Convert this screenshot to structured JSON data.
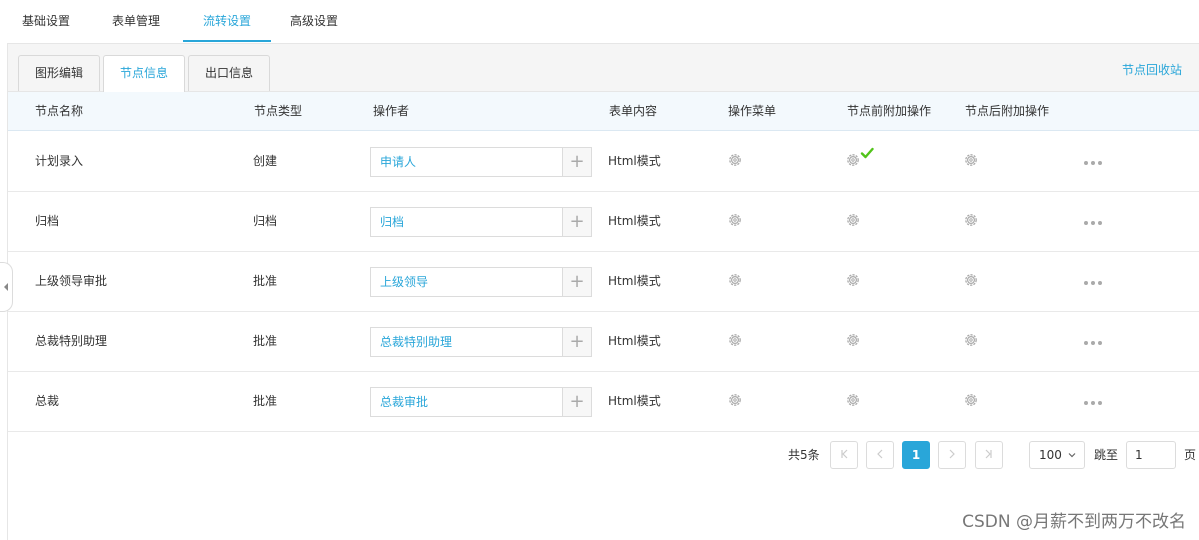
{
  "top_tabs": [
    {
      "label": "基础设置"
    },
    {
      "label": "表单管理"
    },
    {
      "label": "流转设置",
      "active": true
    },
    {
      "label": "高级设置"
    }
  ],
  "sub_tabs": [
    {
      "label": "图形编辑"
    },
    {
      "label": "节点信息",
      "active": true
    },
    {
      "label": "出口信息"
    }
  ],
  "recycle_label": "节点回收站",
  "columns": [
    "节点名称",
    "节点类型",
    "操作者",
    "表单内容",
    "操作菜单",
    "节点前附加操作",
    "节点后附加操作"
  ],
  "rows": [
    {
      "name": "计划录入",
      "type": "创建",
      "operator": "申请人",
      "form": "Html模式",
      "pre_configured": true
    },
    {
      "name": "归档",
      "type": "归档",
      "operator": "归档",
      "form": "Html模式",
      "pre_configured": false
    },
    {
      "name": "上级领导审批",
      "type": "批准",
      "operator": "上级领导",
      "form": "Html模式",
      "pre_configured": false
    },
    {
      "name": "总裁特别助理",
      "type": "批准",
      "operator": "总裁特别助理",
      "form": "Html模式",
      "pre_configured": false
    },
    {
      "name": "总裁",
      "type": "批准",
      "operator": "总裁审批",
      "form": "Html模式",
      "pre_configured": false
    }
  ],
  "pagination": {
    "total_text": "共5条",
    "current_page": "1",
    "page_size": "100",
    "jump_label": "跳至",
    "jump_value": "1",
    "page_suffix": "页"
  },
  "colors": {
    "accent": "#29a6d9",
    "check": "#52c41a"
  },
  "watermark": "CSDN @月薪不到两万不改名"
}
